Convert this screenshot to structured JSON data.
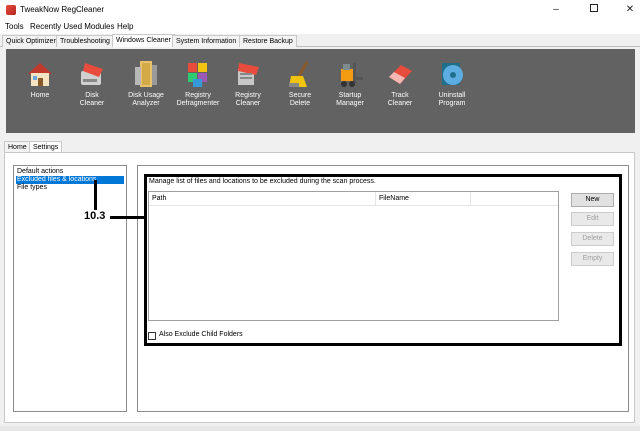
{
  "window": {
    "title": "TweakNow RegCleaner",
    "minimize": "–",
    "close": "✕"
  },
  "menu": [
    "Tools",
    "Recently Used Modules",
    "Help"
  ],
  "main_tabs": [
    "Quick Optimizer",
    "Troubleshooting",
    "Windows Cleaner",
    "System Information",
    "Restore Backup"
  ],
  "main_tabs_active": "Windows Cleaner",
  "toolbar": [
    {
      "label": "Home",
      "icon": "house-icon"
    },
    {
      "label": "Disk\nCleaner",
      "icon": "disk-cleaner-icon"
    },
    {
      "label": "Disk Usage\nAnalyzer",
      "icon": "folder-icon"
    },
    {
      "label": "Registry\nDefragmenter",
      "icon": "blocks-icon"
    },
    {
      "label": "Registry\nCleaner",
      "icon": "registry-cleaner-icon"
    },
    {
      "label": "Secure\nDelete",
      "icon": "broom-icon"
    },
    {
      "label": "Startup\nManager",
      "icon": "forklift-icon"
    },
    {
      "label": "Track\nCleaner",
      "icon": "eraser-icon"
    },
    {
      "label": "Uninstall\nProgram",
      "icon": "disc-icon"
    }
  ],
  "sub_tabs": [
    "Home",
    "Settings"
  ],
  "sub_tabs_active": "Settings",
  "settings_list": [
    "Default actions",
    "Excluded files & locations",
    "File types"
  ],
  "settings_list_selected": "Excluded files & locations",
  "panel": {
    "description": "Manage list of files and locations to be excluded during the scan process.",
    "columns": [
      "Path",
      "FileName",
      ""
    ],
    "buttons": [
      {
        "label": "New",
        "enabled": true
      },
      {
        "label": "Edit",
        "enabled": false
      },
      {
        "label": "Delete",
        "enabled": false
      },
      {
        "label": "Empty",
        "enabled": false
      }
    ],
    "checkbox_label": "Also Exclude Child Folders",
    "checkbox_checked": false
  },
  "annotation": "10.3",
  "colors": {
    "toolbar_bg": "#626262",
    "selection": "#0078d7"
  }
}
